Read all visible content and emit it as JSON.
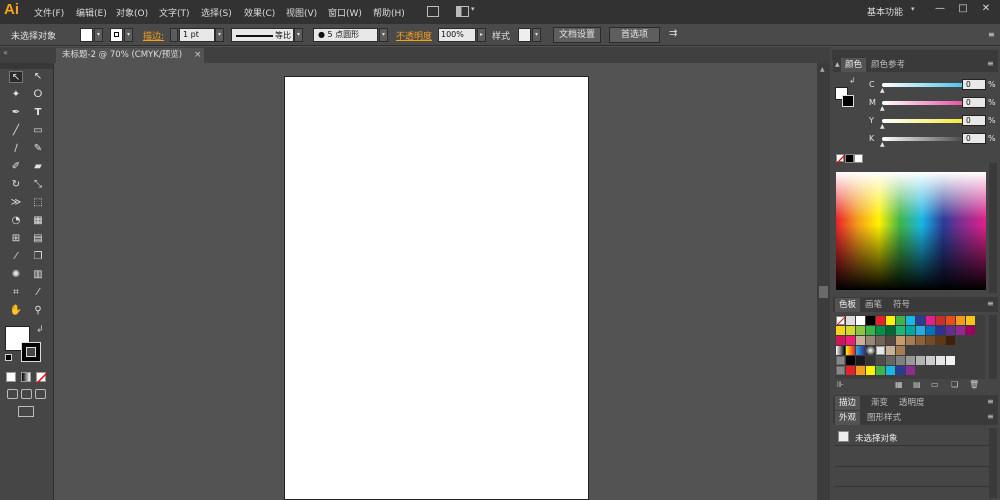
{
  "app": {
    "logo": "Ai"
  },
  "menu": {
    "items": [
      "文件(F)",
      "编辑(E)",
      "对象(O)",
      "文字(T)",
      "选择(S)",
      "效果(C)",
      "视图(V)",
      "窗口(W)",
      "帮助(H)"
    ],
    "workspace": "基本功能",
    "win_min": "—",
    "win_max": "□",
    "win_close": "✕"
  },
  "control": {
    "selection_label": "未选择对象",
    "stroke_label": "描边:",
    "stroke_weight": "1 pt",
    "stroke_profile": "等比",
    "brush": "5 点圆形",
    "opacity_label": "不透明度",
    "opacity_value": "100%",
    "style_label": "样式",
    "doc_setup": "文档设置",
    "prefs": "首选项"
  },
  "document": {
    "tab_title": "未标题-2 @ 70% (CMYK/预览)",
    "close": "×"
  },
  "panels": {
    "color_tabs": [
      "颜色",
      "颜色参考"
    ],
    "color_sliders": [
      {
        "label": "C",
        "value": "0",
        "unit": "%",
        "color": "#19b6e6"
      },
      {
        "label": "M",
        "value": "0",
        "unit": "%",
        "color": "#e0218a"
      },
      {
        "label": "Y",
        "value": "0",
        "unit": "%",
        "color": "#f2e500"
      },
      {
        "label": "K",
        "value": "0",
        "unit": "%",
        "color": "#1a1a1a"
      }
    ],
    "swatch_tabs": [
      "色板",
      "画笔",
      "符号"
    ],
    "stroke_tabs": [
      "描边",
      "渐变",
      "透明度"
    ],
    "appearance_tabs": [
      "外观",
      "图形样式"
    ],
    "appearance_item": "未选择对象"
  },
  "colors": {
    "accent_orange": "#f7a21b",
    "app_bg": "#535353"
  }
}
